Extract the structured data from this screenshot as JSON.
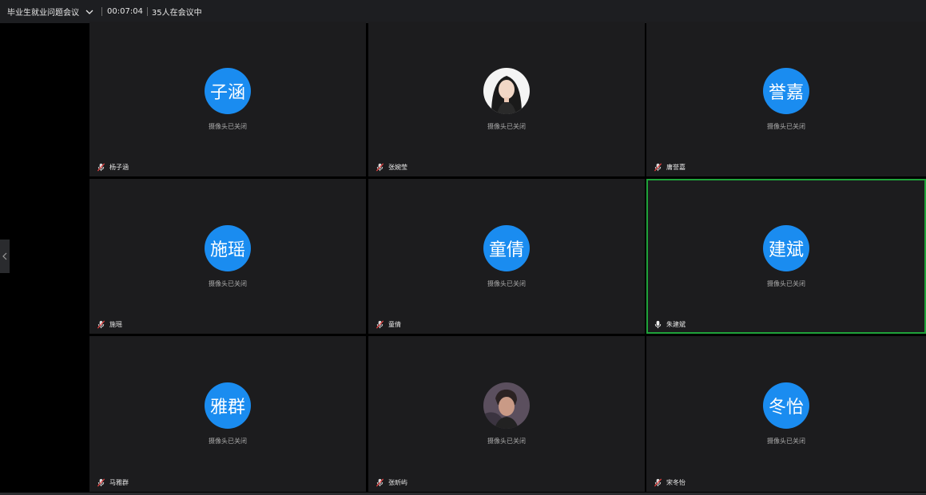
{
  "meeting": {
    "title": "毕业生就业问题会议",
    "timer": "00:07:04",
    "participants_text": "35人在会议中"
  },
  "tiles": [
    {
      "initials": "子涵",
      "camera_status": "摄像头已关闭",
      "name": "杨子涵",
      "mic": "mic-muted-icon"
    },
    {
      "initials": "",
      "camera_status": "摄像头已关闭",
      "name": "张婉莹",
      "mic": "mic-muted-icon",
      "avatar": "photo-woman"
    },
    {
      "initials": "誉嘉",
      "camera_status": "摄像头已关闭",
      "name": "庸誉嘉",
      "mic": "mic-muted-icon"
    },
    {
      "initials": "施瑶",
      "camera_status": "摄像头已关闭",
      "name": "施瑶",
      "mic": "mic-muted-icon"
    },
    {
      "initials": "童倩",
      "camera_status": "摄像头已关闭",
      "name": "童倩",
      "mic": "mic-muted-icon"
    },
    {
      "initials": "建斌",
      "camera_status": "摄像头已关闭",
      "name": "朱建斌",
      "mic": "mic-on-icon",
      "active": true
    },
    {
      "initials": "雅群",
      "camera_status": "摄像头已关闭",
      "name": "马雅群",
      "mic": "mic-muted-icon"
    },
    {
      "initials": "",
      "camera_status": "摄像头已关闭",
      "name": "张昕屿",
      "mic": "mic-muted-icon",
      "avatar": "photo-man"
    },
    {
      "initials": "冬怡",
      "camera_status": "摄像头已关闭",
      "name": "宋冬怡",
      "mic": "mic-muted-icon"
    }
  ],
  "colors": {
    "avatar_bg": "#1a8cf0",
    "active_border": "#1fa23a",
    "tile_bg": "#1c1c1e",
    "topbar_bg": "#1d1e21",
    "muted_mic": "#e04040"
  }
}
